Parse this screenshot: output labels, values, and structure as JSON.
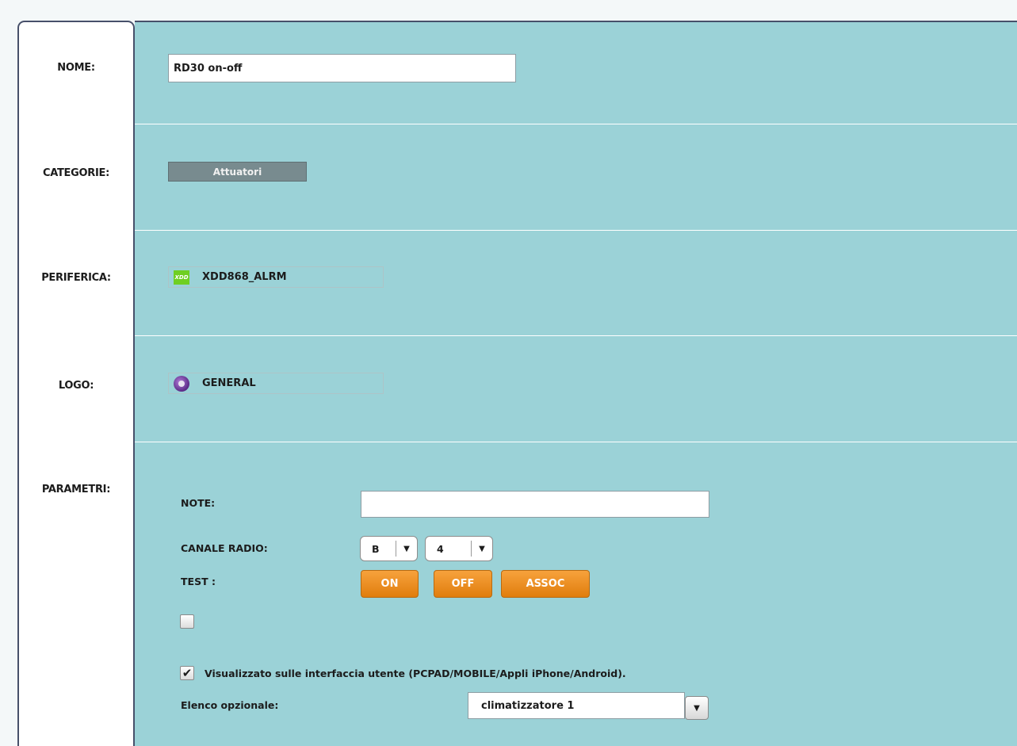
{
  "form": {
    "nome": {
      "label": "NOME:",
      "value": "RD30 on-off"
    },
    "categorie": {
      "label": "CATEGORIE:",
      "value": "Attuatori"
    },
    "periferica": {
      "label": "PERIFERICA:",
      "value": "XDD868_ALRM",
      "icon": "xdd-device-icon",
      "icon_text": "XDD"
    },
    "logo": {
      "label": "LOGO:",
      "value": "GENERAL",
      "icon": "general-logo-icon"
    },
    "parametri": {
      "label": "PARAMETRI:",
      "note": {
        "label": "NOTE:",
        "value": ""
      },
      "canale_radio": {
        "label": "CANALE RADIO:",
        "letter": "B",
        "number": "4"
      },
      "test": {
        "label": "TEST :",
        "on": "ON",
        "off": "OFF",
        "assoc": "ASSOC"
      },
      "extra_checkbox_checked": false,
      "visualizzato": {
        "checked": true,
        "label": "Visualizzato sulle interfaccia utente (PCPAD/MOBILE/Appli iPhone/Android)."
      },
      "elenco_opzionale": {
        "label": "Elenco opzionale:",
        "value": "climatizzatore 1"
      }
    }
  },
  "colors": {
    "panel": "#9bd2d7",
    "button": "#f39422",
    "category": "#788b8f",
    "border": "#47506a"
  }
}
